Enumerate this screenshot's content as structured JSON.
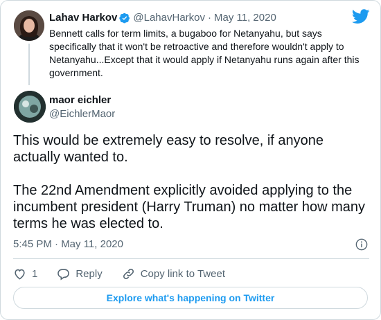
{
  "colors": {
    "accent": "#1d9bf0",
    "muted": "#536471",
    "border": "#cfd9de",
    "text": "#0f1419"
  },
  "parent_tweet": {
    "author_name": "Lahav Harkov",
    "handle": "@LahavHarkov",
    "separator": "·",
    "date": "May 11, 2020",
    "text": "Bennett calls for term limits, a bugaboo for Netanyahu, but says specifically that it won't be retroactive and therefore wouldn't apply to Netanyahu...Except that it would apply if Netanyahu runs again after this government.",
    "verified_icon": "verified-badge-icon"
  },
  "reply_tweet": {
    "author_name": "maor eichler",
    "handle": "@EichlerMaor",
    "paragraph_1": "This would be extremely easy to resolve, if anyone actually wanted to.",
    "paragraph_2": "The 22nd Amendment explicitly avoided applying to the incumbent president (Harry Truman) no matter how many terms he was elected to.",
    "timestamp": "5:45 PM · May 11, 2020"
  },
  "actions": {
    "like_count": "1",
    "reply_label": "Reply",
    "copy_link_label": "Copy link to Tweet"
  },
  "explore_label": "Explore what's happening on Twitter",
  "icons": [
    "twitter-bird-icon",
    "heart-icon",
    "reply-bubble-icon",
    "link-icon",
    "info-icon"
  ]
}
